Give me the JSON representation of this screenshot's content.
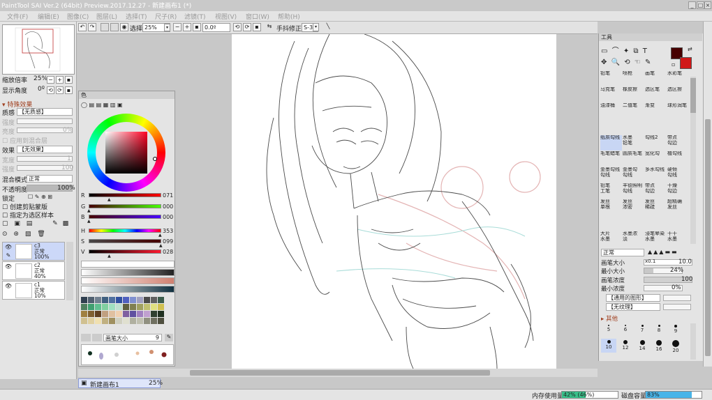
{
  "window": {
    "title": "PaintTool SAI Ver.2 (64bit) Preview.2017.12.27 - 新建画布1 (*)",
    "controls": [
      "_",
      "□",
      "×"
    ]
  },
  "menu": [
    "文件(F)",
    "编辑(E)",
    "图像(C)",
    "图层(L)",
    "选择(T)",
    "尺子(R)",
    "滤镜(T)",
    "视图(V)",
    "窗口(W)",
    "帮助(H)"
  ],
  "toolbar": {
    "select_label": "选择",
    "zoom": "25%",
    "angle": "0.0º",
    "stabilizer_label": "手抖修正",
    "stabilizer_value": "S-3"
  },
  "navigator": {
    "zoom_label": "缩放倍率",
    "zoom_value": "25%",
    "angle_label": "显示角度",
    "angle_value": "0º"
  },
  "layer_props": {
    "effects_header": "特殊效果",
    "texture_label": "质感",
    "texture_value": "【无质感】",
    "scale_label": "强度",
    "scale_value": "",
    "strength_label": "强度",
    "strength_value": "100",
    "brightness_label": "亮度",
    "brightness_value": "0%",
    "apply_label": "应用到混合层",
    "effect_label": "效果",
    "effect_value": "【无效果】",
    "width_label": "宽度",
    "width_value": "1",
    "strength2_label": "强度",
    "strength2_value": "100",
    "blend_label": "混合模式",
    "blend_value": "正常",
    "opacity_label": "不透明度",
    "opacity_value": "100%",
    "lock_label": "锁定",
    "clip_label": "创建剪贴蒙版",
    "ref_label": "指定为选区样本"
  },
  "layers": [
    {
      "name": "c3",
      "mode": "正常",
      "opacity": "100%"
    },
    {
      "name": "c2",
      "mode": "正常",
      "opacity": "40%"
    },
    {
      "name": "c1",
      "mode": "正常",
      "opacity": "10%"
    }
  ],
  "color": {
    "panel_title": "色",
    "r_label": "R",
    "r_value": "071",
    "g_label": "G",
    "g_value": "000",
    "b_label": "B",
    "b_value": "000",
    "h_label": "H",
    "h_value": "353",
    "s_label": "S",
    "s_value": "099",
    "v_label": "V",
    "v_value": "028",
    "brush_size_label": "画笔大小",
    "brush_size_value": "9",
    "primary": "#470000",
    "secondary": "#d01818"
  },
  "tools": {
    "panel_title": "工具",
    "brushes": [
      "铅笔",
      "喷枪",
      "画笔",
      "水彩笔",
      "马克笔",
      "橡皮擦",
      "选区笔",
      "选区擦",
      "油漆桶",
      "二值笔",
      "渐变",
      "球形润笔",
      "",
      "",
      "",
      "",
      "纸质勾线",
      "水墨\n铅笔",
      "勾线2",
      "带点\n勾边",
      "毛笔蜡笔",
      "圆质毛笔",
      "宽化勾",
      "植勾线",
      "金墨勾线\n勾线",
      "金墨勾\n勾线",
      "多水勾线",
      "硬倾\n勾线",
      "铅笔\n工笔",
      "丰德照明\n勾线",
      "带点\n勾边",
      "干燥\n勾边",
      "发丝\n单根",
      "发丝\n浓密",
      "发丝\n稀疏",
      "超精确\n发丝",
      "",
      "",
      "",
      "",
      "大片\n水墨",
      "水墨浓\n淡",
      "浸笔晕染\n水墨",
      "干干\n水墨"
    ],
    "blend_mode": "正常",
    "size_label": "画笔大小",
    "size_mult": "x0.1",
    "size_value": "10.0",
    "min_size_label": "最小大小",
    "min_size_value": "24%",
    "density_label": "画笔浓度",
    "density_value": "100",
    "min_density_label": "最小浓度",
    "min_density_value": "0%",
    "shape_value": "【通用的图形】",
    "texture_value": "【无纹理】",
    "other_label": "其他",
    "dot_sizes": [
      "5",
      "6",
      "7",
      "8",
      "9",
      "10",
      "12",
      "14",
      "16",
      "20"
    ]
  },
  "tabs": [
    {
      "name": "新建画布1",
      "zoom": "25%"
    }
  ],
  "status": {
    "memory_label": "内存使用量",
    "memory_value": "42% (46%)",
    "memory_fraction": 0.42,
    "disk_label": "磁盘容量",
    "disk_value": "83%",
    "disk_fraction": 0.83
  }
}
